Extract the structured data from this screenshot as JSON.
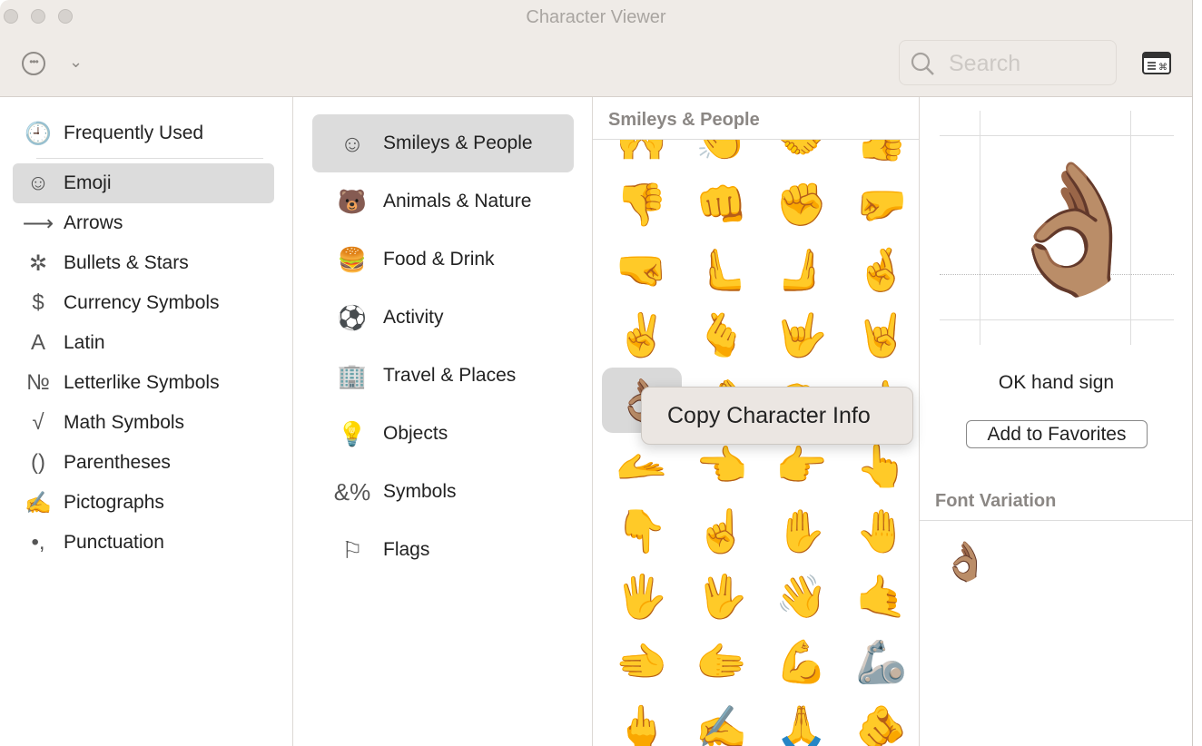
{
  "window": {
    "title": "Character Viewer"
  },
  "toolbar": {
    "more_icon": "ellipsis-circle-icon",
    "dropdown_icon": "chevron-down-icon",
    "search_placeholder": "Search",
    "keyboard_viewer_icon": "keyboard-viewer-icon"
  },
  "sidebar": {
    "items": [
      {
        "label": "Frequently Used",
        "icon": "🕘",
        "selected": false
      },
      {
        "label": "Emoji",
        "icon": "☺",
        "selected": true
      },
      {
        "label": "Arrows",
        "icon": "⟶",
        "selected": false
      },
      {
        "label": "Bullets & Stars",
        "icon": "✲",
        "selected": false
      },
      {
        "label": "Currency Symbols",
        "icon": "$",
        "selected": false
      },
      {
        "label": "Latin",
        "icon": "A",
        "selected": false
      },
      {
        "label": "Letterlike Symbols",
        "icon": "№",
        "selected": false
      },
      {
        "label": "Math Symbols",
        "icon": "√",
        "selected": false
      },
      {
        "label": "Parentheses",
        "icon": "()",
        "selected": false
      },
      {
        "label": "Pictographs",
        "icon": "✍",
        "selected": false
      },
      {
        "label": "Punctuation",
        "icon": "•,",
        "selected": false
      }
    ]
  },
  "categories": {
    "items": [
      {
        "label": "Smileys & People",
        "icon": "☺",
        "selected": true
      },
      {
        "label": "Animals & Nature",
        "icon": "🐻",
        "selected": false
      },
      {
        "label": "Food & Drink",
        "icon": "🍔",
        "selected": false
      },
      {
        "label": "Activity",
        "icon": "⚽",
        "selected": false
      },
      {
        "label": "Travel & Places",
        "icon": "🏢",
        "selected": false
      },
      {
        "label": "Objects",
        "icon": "💡",
        "selected": false
      },
      {
        "label": "Symbols",
        "icon": "&%",
        "selected": false
      },
      {
        "label": "Flags",
        "icon": "⚐",
        "selected": false
      }
    ]
  },
  "grid": {
    "header": "Smileys & People",
    "selected": "👌🏽",
    "emoji": [
      "🙌",
      "👏",
      "🤝",
      "👍",
      "👎",
      "👊",
      "✊",
      "🤛",
      "🤜",
      "🫷",
      "🫸",
      "🤞",
      "✌️",
      "🫰",
      "🤟",
      "🤘",
      "👌🏽",
      "🤌",
      "🤏",
      "👈",
      "🫴",
      "👈",
      "👉",
      "👆",
      "👇",
      "☝️",
      "✋",
      "🤚",
      "🖐",
      "🖖",
      "👋",
      "🤙",
      "🫲",
      "🫱",
      "💪",
      "🦾",
      "🖕",
      "✍️",
      "🙏",
      "🫵"
    ]
  },
  "context_menu": {
    "items": [
      "Copy Character Info"
    ]
  },
  "detail": {
    "character": "👌🏽",
    "name": "OK hand sign",
    "add_favorites": "Add to Favorites",
    "font_variation_header": "Font Variation",
    "variations": [
      "👌🏽"
    ]
  }
}
